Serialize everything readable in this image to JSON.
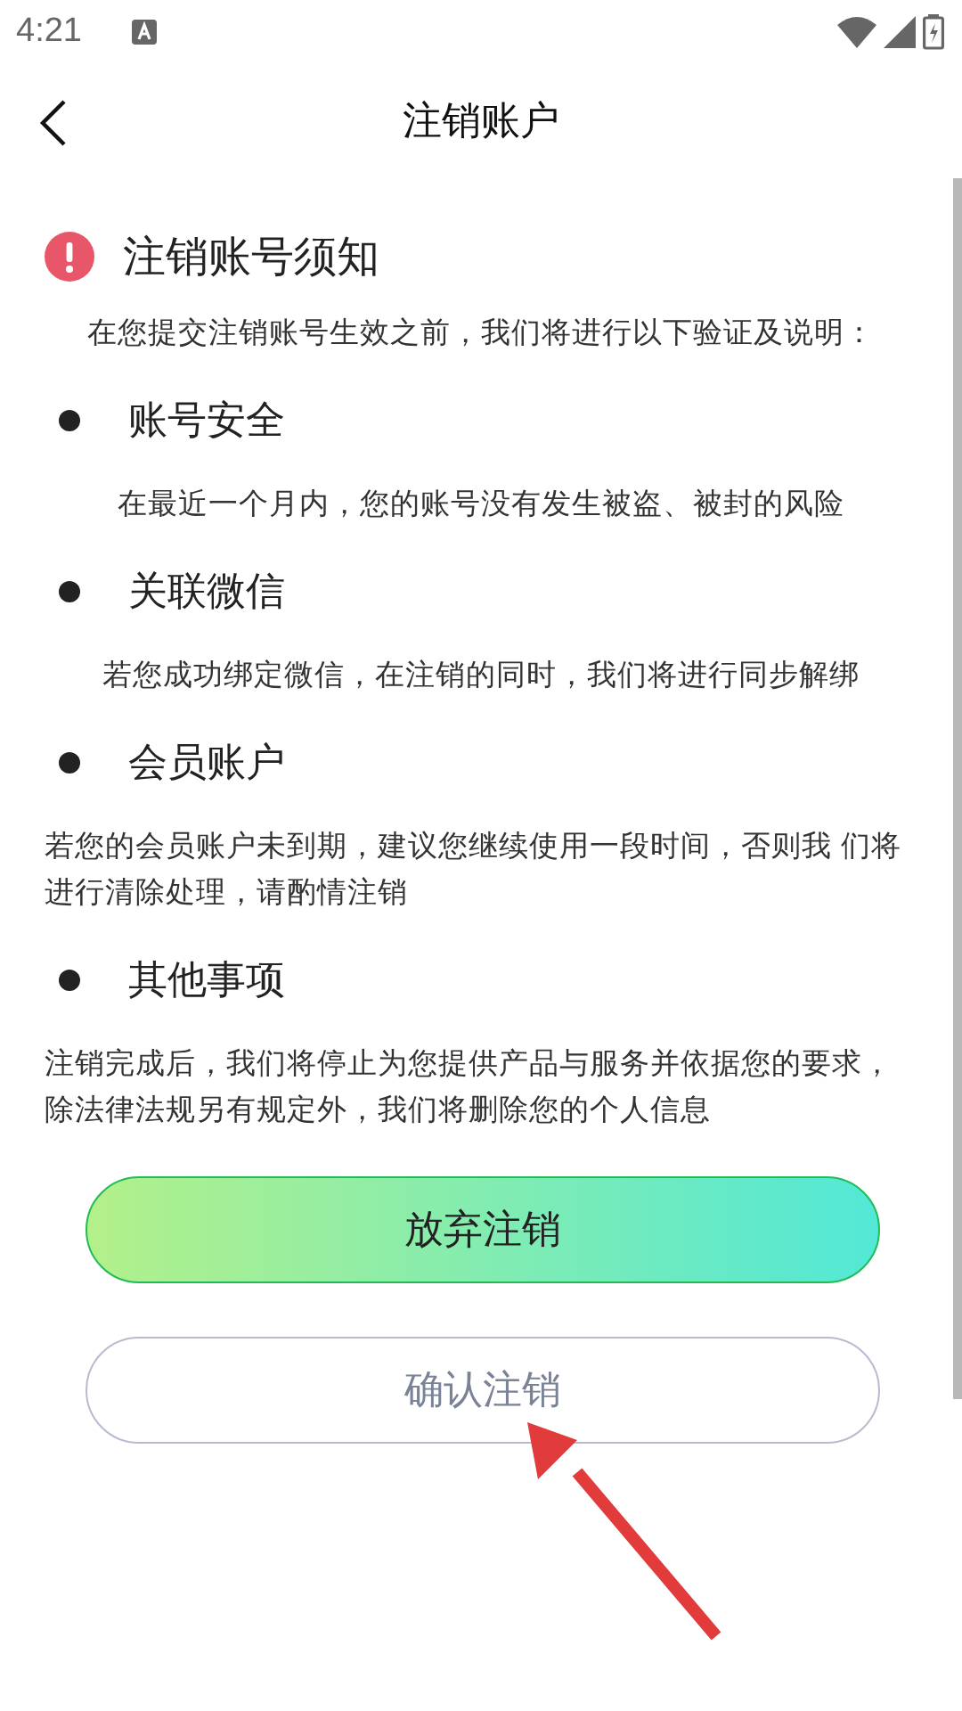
{
  "status_bar": {
    "time": "4:21"
  },
  "header": {
    "title": "注销账户"
  },
  "notice": {
    "title": "注销账号须知",
    "intro": "在您提交注销账号生效之前，我们将进行以下验证及说明："
  },
  "sections": [
    {
      "title": "账号安全",
      "text": "在最近一个月内，您的账号没有发生被盗、被封的风险",
      "kind": "centered"
    },
    {
      "title": "关联微信",
      "text": "若您成功绑定微信，在注销的同时，我们将进行同步解绑",
      "kind": "centered"
    },
    {
      "title": "会员账户",
      "text": "若您的会员账户未到期，建议您继续使用一段时间，否则我 们将进行清除处理，请酌情注销",
      "kind": "flush"
    },
    {
      "title": "其他事项",
      "text": "注销完成后，我们将停止为您提供产品与服务并依据您的要求，除法律法规另有规定外，我们将删除您的个人信息",
      "kind": "flush"
    }
  ],
  "buttons": [
    {
      "label": "放弃注销",
      "kind": "primary"
    },
    {
      "label": "确认注销",
      "kind": "outline"
    }
  ]
}
